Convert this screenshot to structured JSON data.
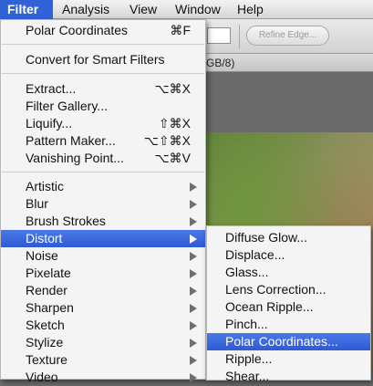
{
  "menubar": {
    "items": [
      "Filter",
      "Analysis",
      "View",
      "Window",
      "Help"
    ],
    "active_index": 0
  },
  "options_bar": {
    "refine_edge_label": "Refine Edge..."
  },
  "document_tab": {
    "mode_text": "GB/8)"
  },
  "filter_menu": {
    "last_filter": {
      "label": "Polar Coordinates",
      "shortcut": "⌘F"
    },
    "convert_smart": "Convert for Smart Filters",
    "plugins": [
      {
        "label": "Extract...",
        "shortcut": "⌥⌘X"
      },
      {
        "label": "Filter Gallery...",
        "shortcut": ""
      },
      {
        "label": "Liquify...",
        "shortcut": "⇧⌘X"
      },
      {
        "label": "Pattern Maker...",
        "shortcut": "⌥⇧⌘X"
      },
      {
        "label": "Vanishing Point...",
        "shortcut": "⌥⌘V"
      }
    ],
    "submenus": [
      {
        "label": "Artistic"
      },
      {
        "label": "Blur"
      },
      {
        "label": "Brush Strokes"
      },
      {
        "label": "Distort",
        "highlighted": true
      },
      {
        "label": "Noise"
      },
      {
        "label": "Pixelate"
      },
      {
        "label": "Render"
      },
      {
        "label": "Sharpen"
      },
      {
        "label": "Sketch"
      },
      {
        "label": "Stylize"
      },
      {
        "label": "Texture"
      },
      {
        "label": "Video"
      }
    ]
  },
  "distort_menu": {
    "items": [
      {
        "label": "Diffuse Glow..."
      },
      {
        "label": "Displace..."
      },
      {
        "label": "Glass..."
      },
      {
        "label": "Lens Correction..."
      },
      {
        "label": "Ocean Ripple..."
      },
      {
        "label": "Pinch..."
      },
      {
        "label": "Polar Coordinates...",
        "highlighted": true
      },
      {
        "label": "Ripple..."
      },
      {
        "label": "Shear..."
      }
    ]
  },
  "colors": {
    "highlight": "#3a66dc",
    "menu_bg": "#f4f4f4"
  }
}
